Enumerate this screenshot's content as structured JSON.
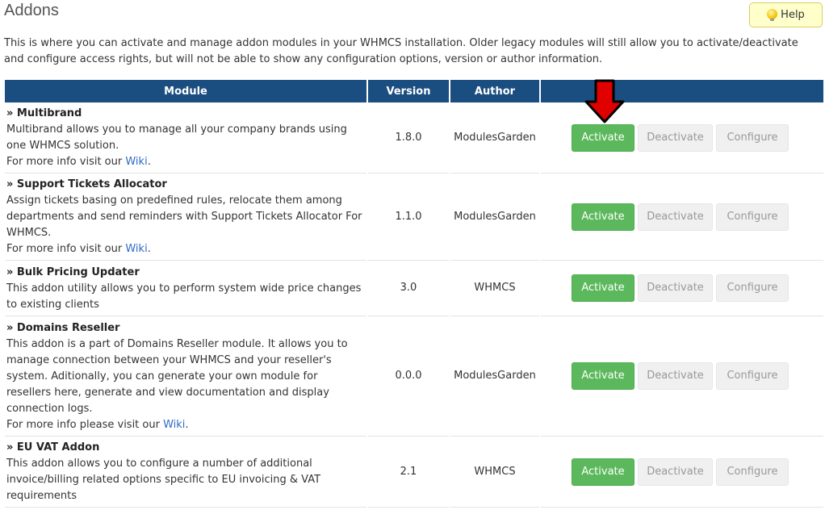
{
  "header": {
    "title": "Addons",
    "help_label": "Help"
  },
  "intro": "This is where you can activate and manage addon modules in your WHMCS installation. Older legacy modules will still allow you to activate/deactivate and configure access rights, but will not be able to show any configuration options, version or author information.",
  "table": {
    "columns": [
      "Module",
      "Version",
      "Author",
      ""
    ],
    "rows": [
      {
        "name": "» Multibrand",
        "description": "Multibrand allows you to manage all your company brands using one WHMCS solution.",
        "more_prefix": "For more info visit our ",
        "link": "Wiki",
        "more_suffix": ".",
        "version": "1.8.0",
        "author": "ModulesGarden"
      },
      {
        "name": "» Support Tickets Allocator",
        "description": "Assign tickets basing on predefined rules, relocate them among departments and send reminders with Support Tickets Allocator For WHMCS.",
        "more_prefix": "For more info visit our ",
        "link": "Wiki",
        "more_suffix": ".",
        "version": "1.1.0",
        "author": "ModulesGarden"
      },
      {
        "name": "» Bulk Pricing Updater",
        "description": "This addon utility allows you to perform system wide price changes to existing clients",
        "version": "3.0",
        "author": "WHMCS"
      },
      {
        "name": "» Domains Reseller",
        "description": "This addon is a part of Domains Reseller module. It allows you to manage connection between your WHMCS and your reseller's system. Aditionally, you can generate your own module for resellers here, generate and view documentation and display connection logs.",
        "more_prefix": "For more info please visit our ",
        "link": "Wiki",
        "more_suffix": ".",
        "version": "0.0.0",
        "author": "ModulesGarden"
      },
      {
        "name": "» EU VAT Addon",
        "description": "This addon allows you to configure a number of additional invoice/billing related options specific to EU invoicing & VAT requirements",
        "version": "2.1",
        "author": "WHMCS"
      }
    ],
    "buttons": {
      "activate": "Activate",
      "deactivate": "Deactivate",
      "configure": "Configure"
    }
  },
  "colors": {
    "header_bg": "#1a4d80",
    "activate_bg": "#5cb85c",
    "link": "#2d6bc5",
    "help_bg": "#ffffcc",
    "annotation_arrow": "#e00000"
  },
  "icons": {
    "help": "lightbulb-icon",
    "annotation": "arrow-down-icon"
  }
}
